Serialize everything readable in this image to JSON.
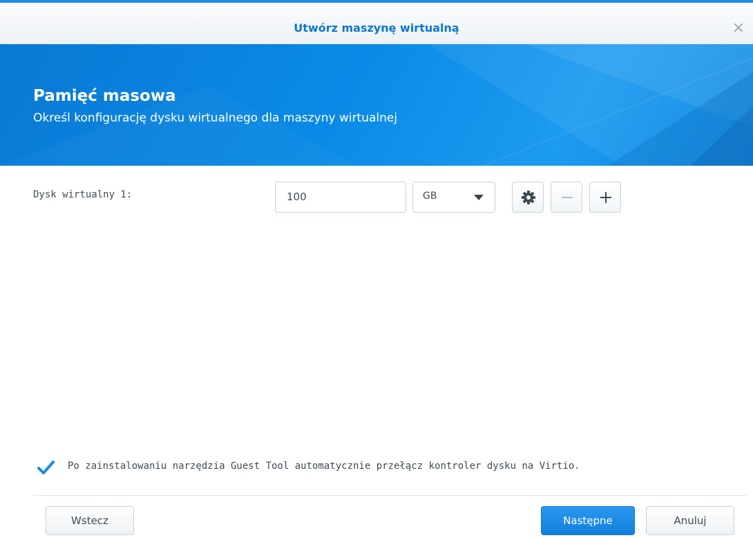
{
  "dialog": {
    "title": "Utwórz maszynę wirtualną",
    "close_symbol": "×"
  },
  "banner": {
    "title": "Pamięć masowa",
    "subtitle": "Określ konfigurację dysku wirtualnego dla maszyny wirtualnej"
  },
  "disk": {
    "label": "Dysk wirtualny 1:",
    "size_value": "100",
    "unit_value": "GB",
    "icons": {
      "settings": "gear-icon",
      "remove": "minus-icon",
      "add": "plus-icon"
    }
  },
  "options": {
    "auto_virtio_label": "Po zainstalowaniu narzędzia Guest Tool automatycznie przełącz kontroler dysku na Virtio.",
    "auto_virtio_checked": true
  },
  "footer": {
    "back_label": "Wstecz",
    "next_label": "Następne",
    "cancel_label": "Anuluj"
  },
  "colors": {
    "accent": "#0b78d0",
    "banner_blue": "#0a8ae6",
    "primary_button": "#1a8ce6",
    "check_blue": "#1a8ce6"
  }
}
